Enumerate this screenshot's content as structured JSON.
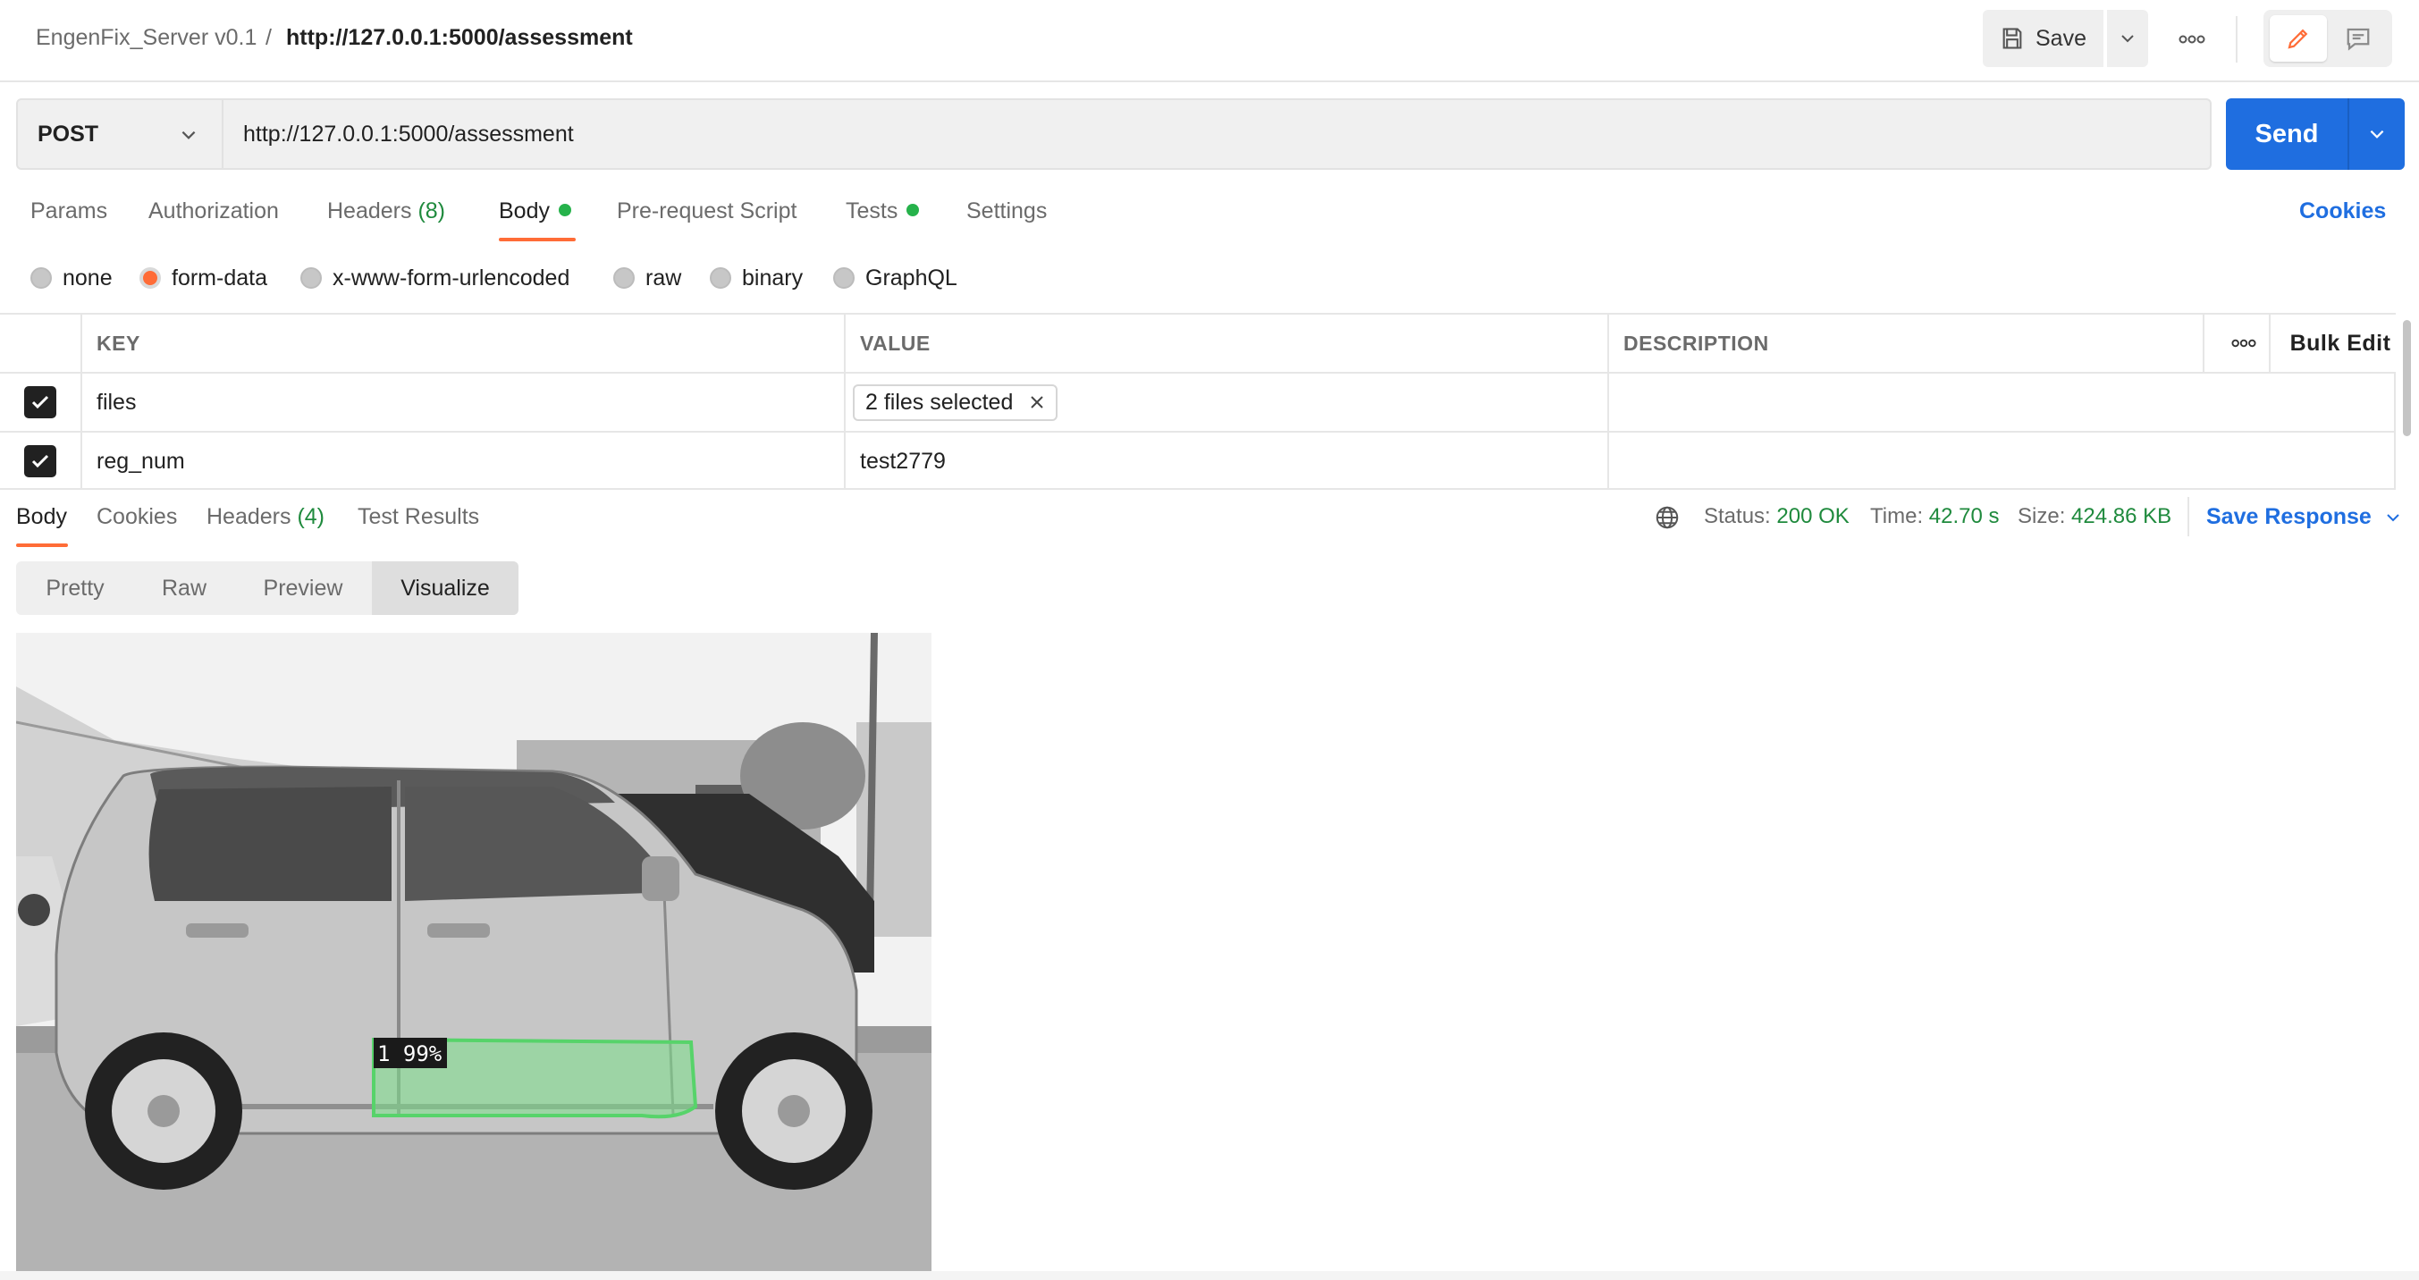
{
  "header": {
    "workspace": "EngenFix_Server v0.1",
    "separator": "/",
    "title": "http://127.0.0.1:5000/assessment",
    "save_label": "Save"
  },
  "request": {
    "method": "POST",
    "url": "http://127.0.0.1:5000/assessment",
    "send_label": "Send",
    "tabs": [
      {
        "label": "Params"
      },
      {
        "label": "Authorization"
      },
      {
        "label": "Headers",
        "count": "(8)"
      },
      {
        "label": "Body"
      },
      {
        "label": "Pre-request Script"
      },
      {
        "label": "Tests"
      },
      {
        "label": "Settings"
      }
    ],
    "active_tab": "Body",
    "cookies_label": "Cookies"
  },
  "body_types": {
    "options": [
      "none",
      "form-data",
      "x-www-form-urlencoded",
      "raw",
      "binary",
      "GraphQL"
    ],
    "selected": "form-data"
  },
  "form_table": {
    "headers": {
      "key": "KEY",
      "value": "VALUE",
      "description": "DESCRIPTION",
      "bulk_edit": "Bulk Edit"
    },
    "rows": [
      {
        "checked": true,
        "key": "files",
        "value": "2 files selected",
        "description": ""
      },
      {
        "checked": true,
        "key": "reg_num",
        "value": "test2779",
        "description": ""
      }
    ]
  },
  "response": {
    "tabs": [
      {
        "label": "Body"
      },
      {
        "label": "Cookies"
      },
      {
        "label": "Headers",
        "count": "(4)"
      },
      {
        "label": "Test Results"
      }
    ],
    "active_tab": "Body",
    "status_label": "Status:",
    "status_value": "200 OK",
    "time_label": "Time:",
    "time_value": "42.70 s",
    "size_label": "Size:",
    "size_value": "424.86 KB",
    "save_response_label": "Save Response",
    "view_modes": [
      "Pretty",
      "Raw",
      "Preview",
      "Visualize"
    ],
    "active_view": "Visualize",
    "visualization": {
      "detection_label": "1 99%"
    }
  },
  "colors": {
    "accent_orange": "#ff6c37",
    "send_blue": "#1f6ee0",
    "status_green": "#1f8a3d",
    "dot_green": "#26b24b",
    "detection_green": "#7be08a"
  },
  "icons": [
    "save-icon",
    "chevron-down-icon",
    "more-icon",
    "pencil-icon",
    "comment-icon",
    "checkmark-icon",
    "close-icon",
    "globe-icon"
  ]
}
